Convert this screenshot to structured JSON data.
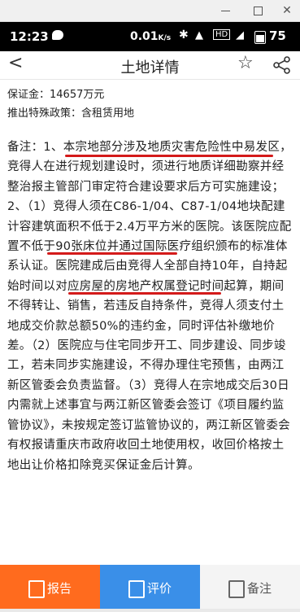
{
  "window": {
    "minimize_label": "",
    "maximize_label": "",
    "close_label": "✕"
  },
  "status_bar": {
    "time": "12:23",
    "speed": "0.01",
    "speed_unit": "K/s",
    "battery": "75",
    "network_label": "HD"
  },
  "nav": {
    "back_icon": "chevron-left-icon",
    "title": "土地详情",
    "star_icon": "star-outline-icon",
    "share_icon": "share-icon"
  },
  "content": {
    "deposit": "保证金：14657万元",
    "policy": "推出特殊政策：含租赁用地",
    "notes": "备注：1、本宗地部分涉及地质灾害危险性中易发区，竞得人在进行规划建设时，须进行地质详细勘察并经整治报主管部门审定符合建设要求后方可实施建设；2、（1）竞得人须在C86-1/04、C87-1/04地块配建计容建筑面积不低于2.4万平方米的医院。该医院应配置不低于90张床位并通过国际医疗组织颁布的标准体系认证。医院建成后由竞得人全部自持10年，自持起始时间以对应房屋的房地产权属登记时间起算，期间不得转让、销售，若违反自持条件，竞得人须支付土地成交价款总额50%的违约金，同时评估补缴地价差。（2）医院应与住宅同步开工、同步建设、同步竣工，若未同步实施建设，不得办理住宅预售，由两江新区管委会负责监督。（3）竞得人在宗地成交后30日内需就上述事宜与两江新区管委会签订《项目履约监管协议》，未按规定签订监管协议的，两江新区管委会有权报请重庆市政府收回土地使用权，收回价格按土地出让价格扣除竞买保证金后计算。"
  },
  "bottom_tabs": [
    {
      "label": "报告",
      "icon": "report-icon",
      "color": "#ff6b1e"
    },
    {
      "label": "评价",
      "icon": "evaluate-icon",
      "color": "#3a8fe8"
    },
    {
      "label": "备注",
      "icon": "note-icon",
      "color": "#f4f4f4"
    }
  ],
  "colors": {
    "highlight_underline": "#d41a1a"
  }
}
